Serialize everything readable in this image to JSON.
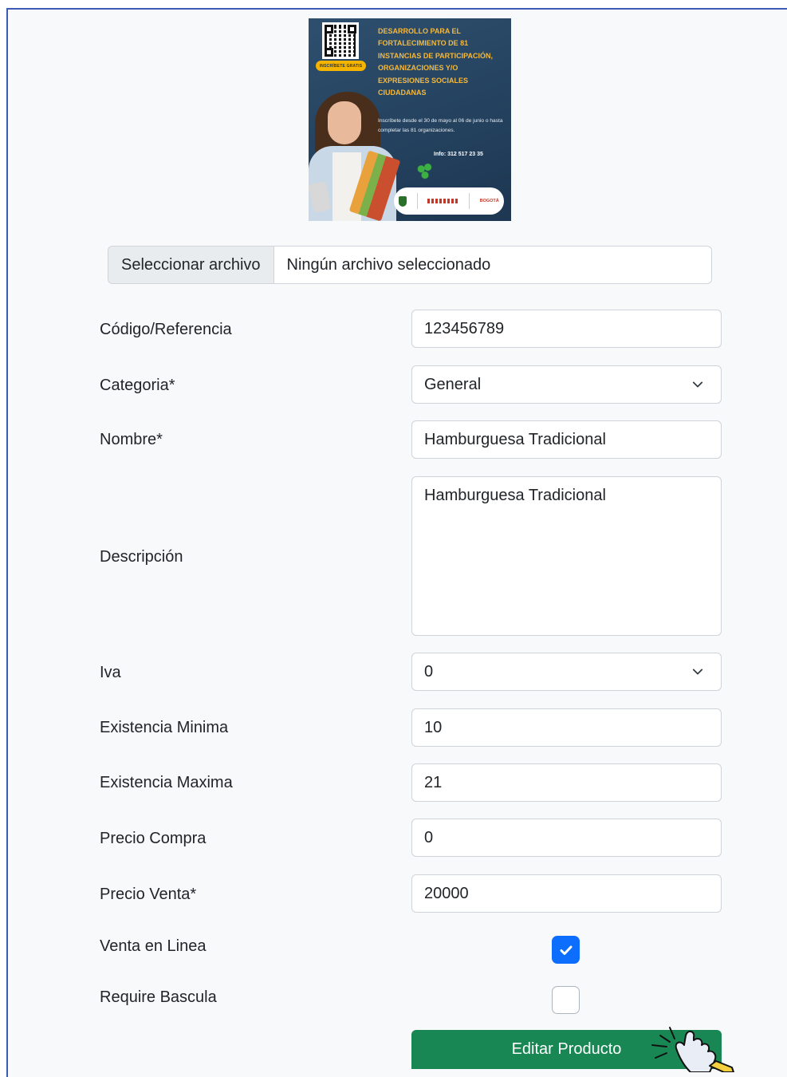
{
  "poster": {
    "badge": "INSCRÍBETE GRATIS",
    "headline": "DESARROLLO PARA EL FORTALECIMIENTO DE 81 INSTANCIAS DE PARTICIPACIÓN, ORGANIZACIONES Y/O EXPRESIONES SOCIALES CIUDADANAS",
    "body": "Inscríbete desde el 30 de mayo al 06 de junio o hasta completar las 81 organizaciones.",
    "info": "Info: 312 517 23 35",
    "logo_text": "BOGOTÁ"
  },
  "file_input": {
    "button_label": "Seleccionar archivo",
    "status": "Ningún archivo seleccionado"
  },
  "form": {
    "codigo": {
      "label": "Código/Referencia",
      "value": "123456789"
    },
    "categoria": {
      "label": "Categoria*",
      "value": "General"
    },
    "nombre": {
      "label": "Nombre*",
      "value": "Hamburguesa Tradicional"
    },
    "descripcion": {
      "label": "Descripción",
      "value": "Hamburguesa Tradicional"
    },
    "iva": {
      "label": "Iva",
      "value": "0"
    },
    "existencia_minima": {
      "label": "Existencia Minima",
      "value": "10"
    },
    "existencia_maxima": {
      "label": "Existencia Maxima",
      "value": "21"
    },
    "precio_compra": {
      "label": "Precio Compra",
      "value": "0"
    },
    "precio_venta": {
      "label": "Precio Venta*",
      "value": "20000"
    },
    "venta_en_linea": {
      "label": "Venta en Linea",
      "checked": true
    },
    "require_bascula": {
      "label": "Require Bascula",
      "checked": false
    }
  },
  "submit": {
    "label": "Editar Producto"
  },
  "colors": {
    "primary": "#0d6efd",
    "success": "#198754",
    "border": "#ced4da"
  }
}
